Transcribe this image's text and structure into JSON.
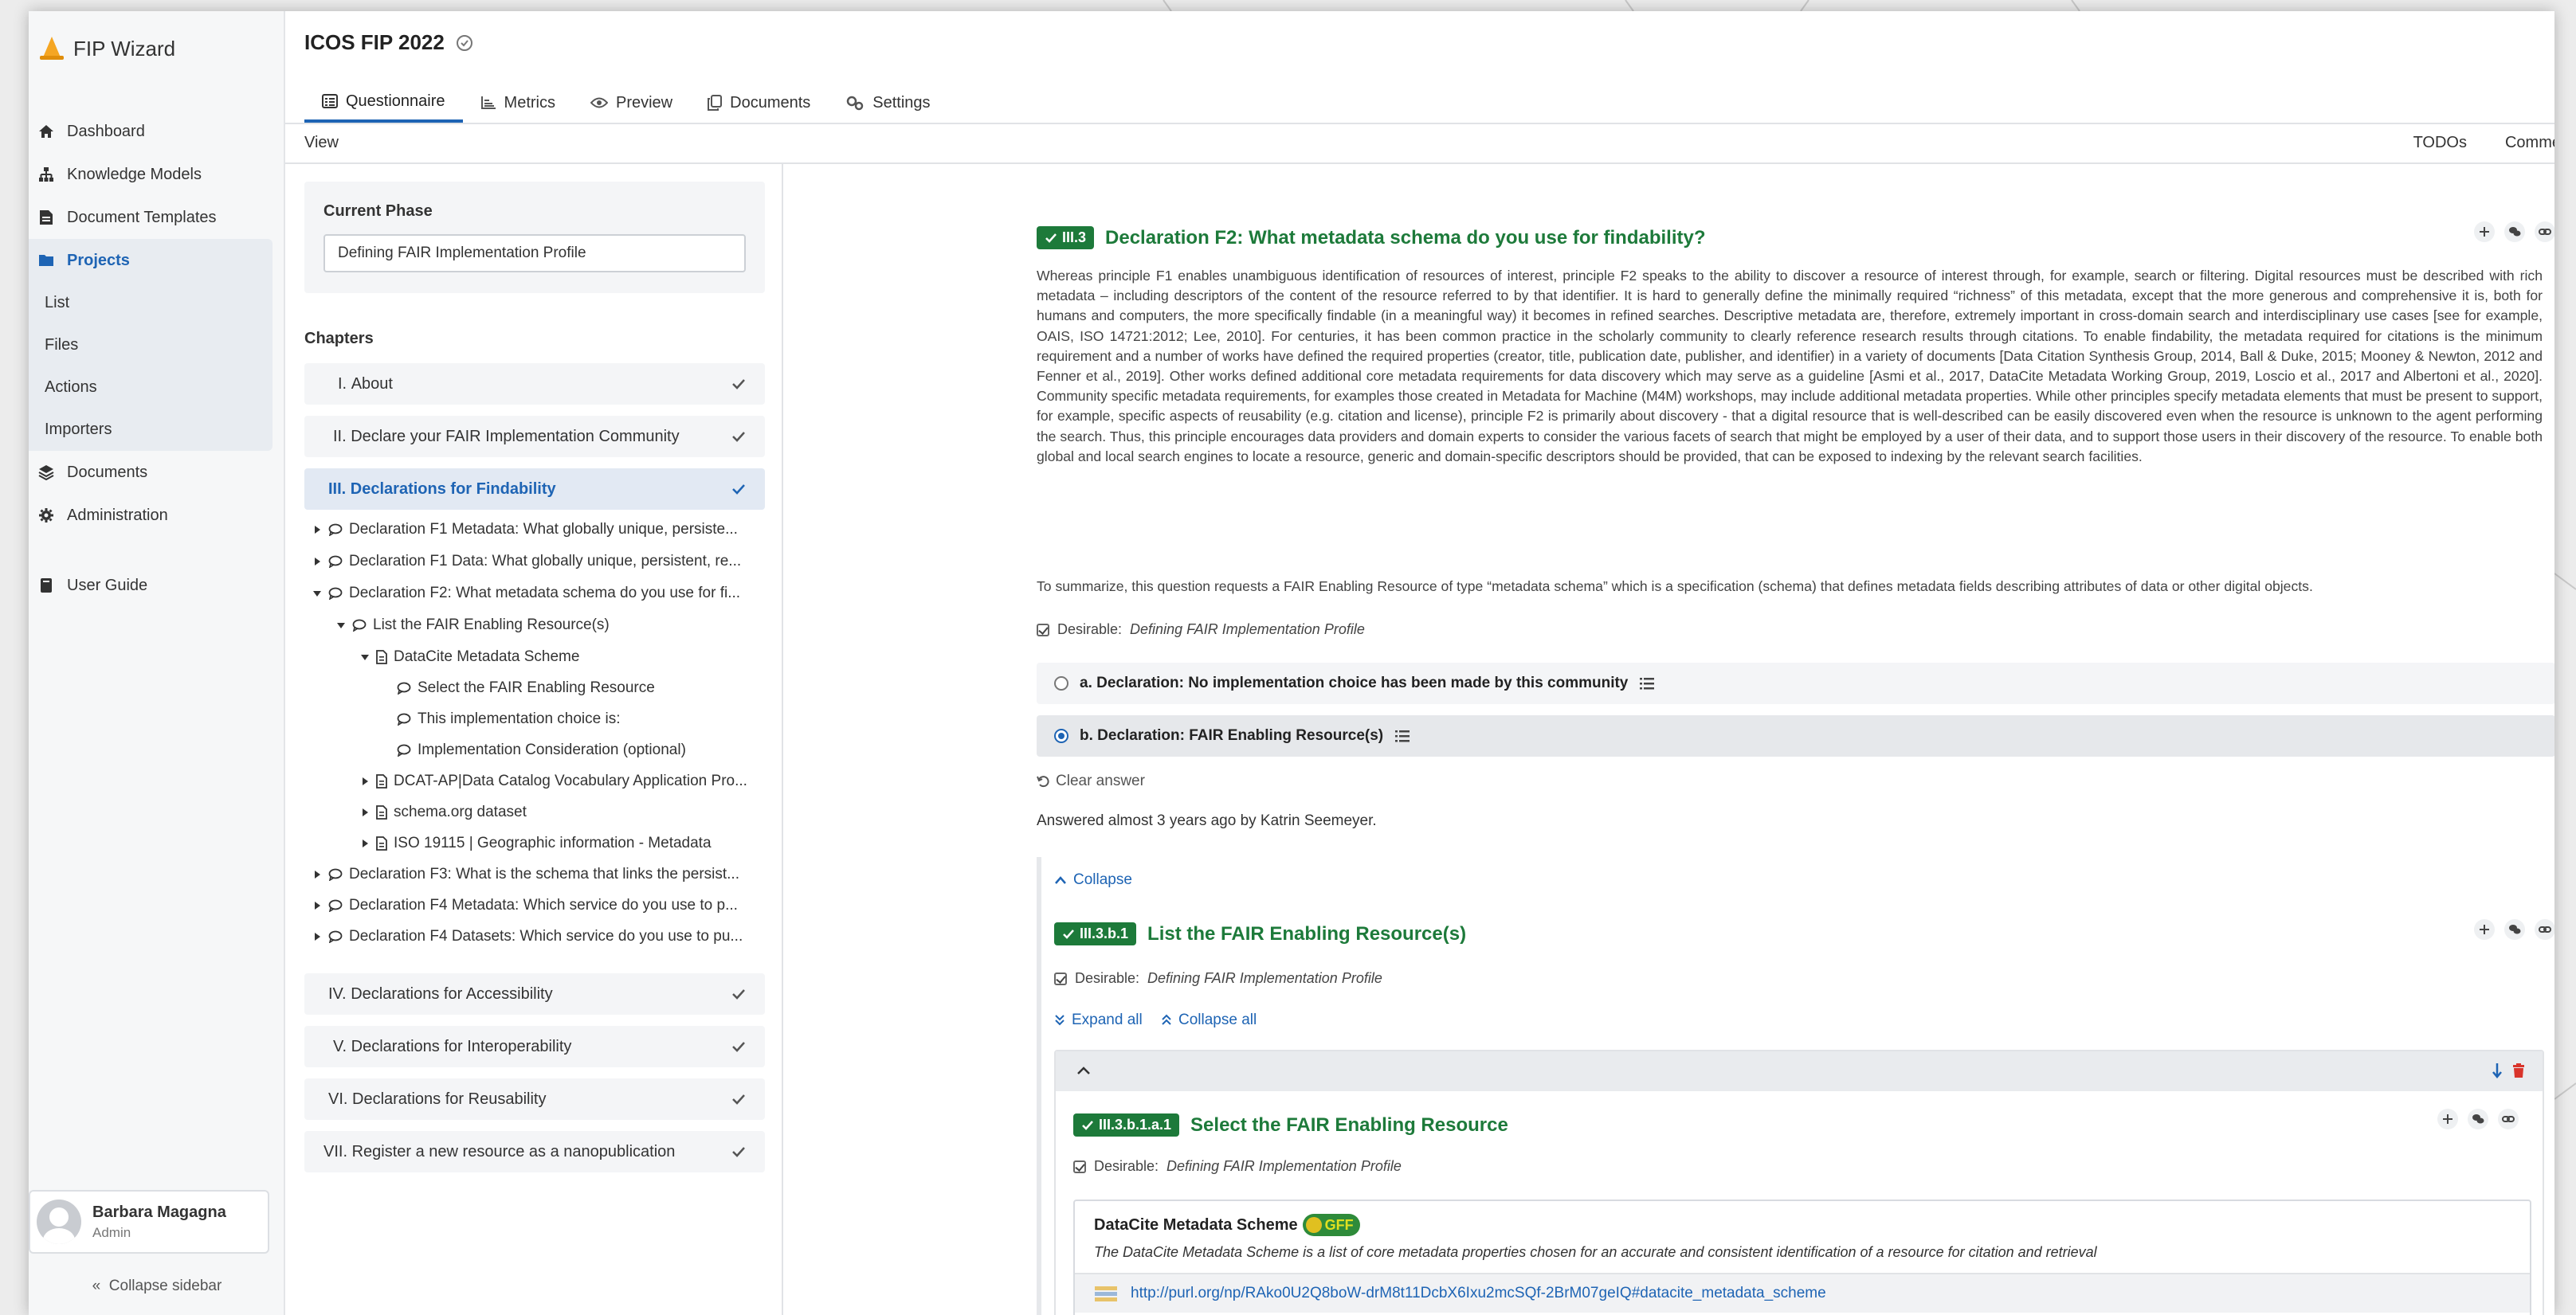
{
  "brand": {
    "name": "FIP Wizard"
  },
  "sidebar": {
    "items": [
      {
        "label": "Dashboard",
        "icon": "home-icon"
      },
      {
        "label": "Knowledge Models",
        "icon": "sitemap-icon"
      },
      {
        "label": "Document Templates",
        "icon": "file-template-icon"
      },
      {
        "label": "Projects",
        "icon": "folder-icon"
      },
      {
        "label": "Documents",
        "icon": "layers-icon"
      },
      {
        "label": "Administration",
        "icon": "cog-icon"
      },
      {
        "label": "User Guide",
        "icon": "book-icon"
      }
    ],
    "project_sub": [
      "List",
      "Files",
      "Actions",
      "Importers"
    ],
    "user": {
      "name": "Barbara Magagna",
      "role": "Admin"
    },
    "collapse_label": "Collapse sidebar"
  },
  "header": {
    "project_title": "ICOS FIP 2022",
    "tabs": [
      {
        "label": "Questionnaire",
        "icon": "list-alt-icon"
      },
      {
        "label": "Metrics",
        "icon": "chart-icon"
      },
      {
        "label": "Preview",
        "icon": "eye-icon"
      },
      {
        "label": "Documents",
        "icon": "copy-icon"
      },
      {
        "label": "Settings",
        "icon": "cogs-icon"
      }
    ],
    "view_label": "View",
    "todos_label": "TODOs",
    "comments_label": "Comme"
  },
  "phase": {
    "label": "Current Phase",
    "value": "Defining FAIR Implementation Profile"
  },
  "chapters": {
    "title": "Chapters",
    "items": [
      {
        "num": "I.",
        "label": "About"
      },
      {
        "num": "II.",
        "label": "Declare your FAIR Implementation Community"
      },
      {
        "num": "III.",
        "label": "Declarations for Findability"
      },
      {
        "num": "IV.",
        "label": "Declarations for Accessibility"
      },
      {
        "num": "V.",
        "label": "Declarations for Interoperability"
      },
      {
        "num": "VI.",
        "label": "Declarations for Reusability"
      },
      {
        "num": "VII.",
        "label": "Register a new resource as a nanopublication"
      }
    ],
    "tree": [
      "Declaration F1 Metadata: What globally unique, persiste...",
      "Declaration F1 Data: What globally unique, persistent, re...",
      "Declaration F2: What metadata schema do you use for fi...",
      "List the FAIR Enabling Resource(s)",
      "DataCite Metadata Scheme",
      "Select the FAIR Enabling Resource",
      "This implementation choice is:",
      "Implementation Consideration (optional)",
      "DCAT-AP|Data Catalog Vocabulary Application Pro...",
      "schema.org dataset",
      "ISO 19115 | Geographic information - Metadata",
      "Declaration F3: What is the schema that links the persist...",
      "Declaration F4 Metadata: Which service do you use to p...",
      "Declaration F4 Datasets: Which service do you use to pu..."
    ]
  },
  "question": {
    "badge": "III.3",
    "title": "Declaration F2: What metadata schema do you use for findability?",
    "description": "Whereas principle F1 enables unambiguous identification of resources of interest, principle F2 speaks to the ability to discover a resource of interest through, for example, search or filtering. Digital resources must be described with rich metadata – including descriptors of the content of the resource referred to by that identifier. It is hard to generally define the minimally required “richness” of this metadata, except that the more generous and comprehensive it is, both for humans and computers, the more specifically findable (in a meaningful way) it becomes in refined searches. Descriptive metadata are, therefore, extremely important in cross-domain search and interdisciplinary use cases [see for example, OAIS, ISO 14721:2012; Lee, 2010]. For centuries, it has been common practice in the scholarly community to clearly reference research results through citations. To enable findability, the metadata required for citations is the minimum requirement and a number of works have defined the required properties (creator, title, publication date, publisher, and identifier) in a variety of documents [Data Citation Synthesis Group, 2014, Ball & Duke, 2015; Mooney & Newton, 2012 and Fenner et al., 2019]. Other works defined additional core metadata requirements for data discovery which may serve as a guideline [Asmi et al., 2017, DataCite Metadata Working Group, 2019, Loscio et al., 2017 and Albertoni et al., 2020]. Community specific metadata requirements, for examples those created in Metadata for Machine (M4M) workshops, may include additional metadata properties. While other principles specify metadata elements that must be present to support, for example, specific aspects of reusability (e.g. citation and license), principle F2 is primarily about discovery - that a digital resource that is well-described can be easily discovered even when the resource is unknown to the agent performing the search. Thus, this principle encourages data providers and domain experts to consider the various facets of search that might be employed by a user of their data, and to support those users in their discovery of the resource. To enable both global and local search engines to locate a resource, generic and domain-specific descriptors should be provided, that can be exposed to indexing by the relevant search facilities.",
    "summary": "To summarize, this question requests a FAIR Enabling Resource of type “metadata schema” which is a specification (schema) that defines metadata fields describing attributes of data or other digital objects.",
    "desirable_prefix": "Desirable:",
    "desirable_phase": "Defining FAIR Implementation Profile",
    "answers": [
      "a. Declaration: No implementation choice has been made by this community",
      "b. Declaration: FAIR Enabling Resource(s)"
    ],
    "clear_answer": "Clear answer",
    "answered_by": "Answered almost 3 years ago by Katrin Seemeyer.",
    "collapse": "Collapse"
  },
  "sub_question": {
    "badge": "III.3.b.1",
    "title": "List the FAIR Enabling Resource(s)",
    "expand_all": "Expand all",
    "collapse_all": "Collapse all"
  },
  "item_question": {
    "badge": "III.3.b.1.a.1",
    "title": "Select the FAIR Enabling Resource"
  },
  "fer": {
    "name": "DataCite Metadata Scheme",
    "badge_text": "GFF",
    "description": "The DataCite Metadata Scheme is a list of core metadata properties chosen for an accurate and consistent identification of a resource for citation and retrieval",
    "url": "http://purl.org/np/RAko0U2Q8boW-drM8t11DcbX6Ixu2mcSQf-2BrM07geIQ#datacite_metadata_scheme"
  }
}
